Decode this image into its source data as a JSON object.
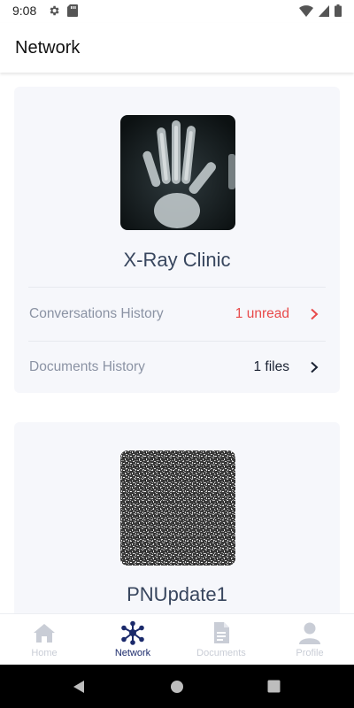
{
  "status_bar": {
    "time": "9:08"
  },
  "app_bar": {
    "title": "Network"
  },
  "cards": [
    {
      "name": "X-Ray Clinic",
      "rows": [
        {
          "label": "Conversations History",
          "value": "1 unread",
          "value_color": "#e84a4a",
          "chevron_color": "#e84a4a"
        },
        {
          "label": "Documents History",
          "value": "1 files",
          "value_color": "#1a2233",
          "chevron_color": "#1a2233"
        }
      ]
    },
    {
      "name": "PNUpdate1"
    }
  ],
  "bottom_nav": {
    "items": [
      {
        "label": "Home",
        "icon": "home-icon",
        "active": false
      },
      {
        "label": "Network",
        "icon": "network-icon",
        "active": true
      },
      {
        "label": "Documents",
        "icon": "document-icon",
        "active": false
      },
      {
        "label": "Profile",
        "icon": "profile-icon",
        "active": false
      }
    ]
  },
  "colors": {
    "accent": "#1b2a6b",
    "inactive": "#c9cdd6",
    "card_bg": "#f6f7fb",
    "alert": "#e84a4a"
  }
}
